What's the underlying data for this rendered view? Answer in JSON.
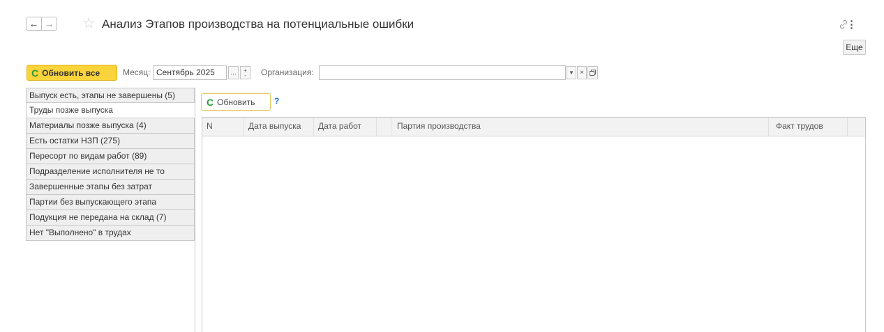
{
  "header": {
    "title": "Анализ Этапов производства на потенциальные ошибки",
    "back_icon": "←",
    "forward_icon": "→",
    "star_icon": "☆",
    "link_icon": "🔗",
    "more_menu_icon": "⋮",
    "more_button": "Еще"
  },
  "toolbar": {
    "refresh_all_label": "Обновить все",
    "month_label": "Месяц:",
    "month_value": "Сентябрь 2025",
    "org_label": "Организация:",
    "org_value": ""
  },
  "checks": [
    {
      "label": "Выпуск есть, этапы не завершены (5)",
      "selected": false
    },
    {
      "label": "Труды позже выпуска",
      "selected": true
    },
    {
      "label": "Материалы позже выпуска (4)",
      "selected": false
    },
    {
      "label": "Есть остатки НЗП (275)",
      "selected": false
    },
    {
      "label": "Пересорт по видам работ (89)",
      "selected": false
    },
    {
      "label": "Подразделение исполнителя не то",
      "selected": false
    },
    {
      "label": "Завершенные этапы без затрат",
      "selected": false
    },
    {
      "label": "Партии без выпускающего этапа",
      "selected": false
    },
    {
      "label": "Подукция не передана на склад (7)",
      "selected": false
    },
    {
      "label": "Нет \"Выполнено\" в трудах",
      "selected": false
    }
  ],
  "panel": {
    "refresh_label": "Обновить",
    "help_label": "?",
    "columns": [
      "N",
      "Дата выпуска",
      "Дата работ",
      "",
      "Партия производства",
      "Факт трудов",
      ""
    ],
    "rows": []
  },
  "colors": {
    "accent_yellow": "#fbd33a",
    "refresh_green": "#2a9a3a",
    "help_blue": "#2a6bd6"
  }
}
